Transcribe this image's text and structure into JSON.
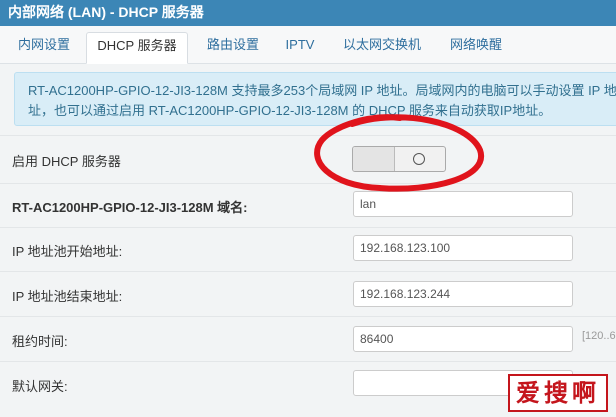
{
  "window": {
    "title": "内部网络 (LAN) - DHCP 服务器"
  },
  "tabs": [
    {
      "label": "内网设置"
    },
    {
      "label": "DHCP 服务器"
    },
    {
      "label": "路由设置"
    },
    {
      "label": "IPTV"
    },
    {
      "label": "以太网交换机"
    },
    {
      "label": "网络唤醒"
    }
  ],
  "info": {
    "line1": "RT-AC1200HP-GPIO-12-JI3-128M 支持最多253个局域网 IP 地址。局域网内的电脑可以手动设置 IP 地",
    "line2": "址，也可以通过启用 RT-AC1200HP-GPIO-12-JI3-128M 的 DHCP 服务来自动获取IP地址。"
  },
  "fields": {
    "dhcp_enable_label": "启用 DHCP 服务器",
    "domain_label": "RT-AC1200HP-GPIO-12-JI3-128M 域名:",
    "domain_value": "lan",
    "pool_start_label": "IP 地址池开始地址:",
    "pool_start_value": "192.168.123.100",
    "pool_end_label": "IP 地址池结束地址:",
    "pool_end_value": "192.168.123.244",
    "lease_label": "租约时间:",
    "lease_value": "86400",
    "lease_hint": "[120..6",
    "gateway_label": "默认网关:",
    "gateway_value": ""
  },
  "toggle": {
    "state": "off"
  },
  "watermark": {
    "text": "爱搜啊"
  },
  "colors": {
    "title_bar": "#3c86b6",
    "info_bg": "#d9edf7",
    "annotation_red": "#e0141c"
  }
}
